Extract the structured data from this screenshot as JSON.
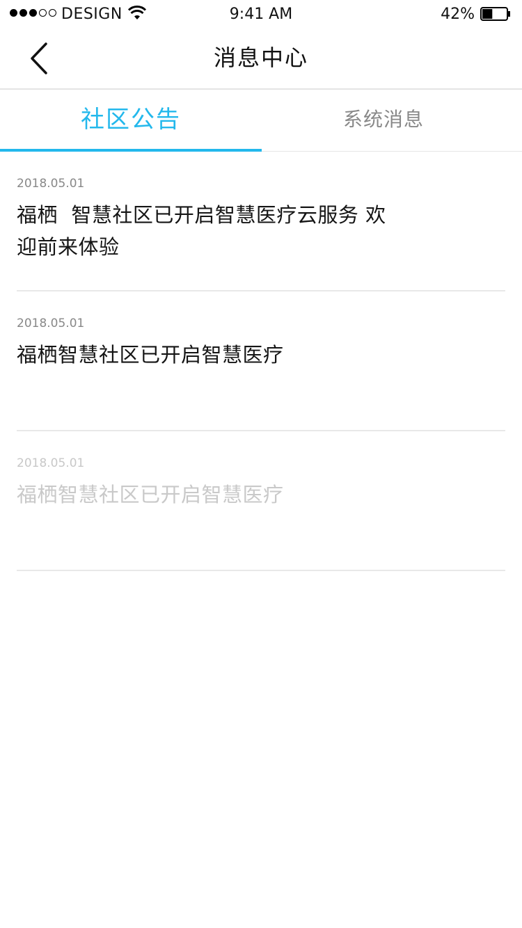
{
  "status_bar": {
    "carrier": "DESIGN",
    "time": "9:41 AM",
    "battery_percent": "42%",
    "battery_level": 0.42,
    "signal_strength": 3,
    "signal_max": 5
  },
  "nav": {
    "title": "消息中心",
    "back_icon": "chevron-left-icon"
  },
  "tabs": [
    {
      "label": "社区公告",
      "active": true
    },
    {
      "label": "系统消息",
      "active": false
    }
  ],
  "colors": {
    "accent": "#23b8ec",
    "muted_text": "#888888",
    "faded_text": "#c9c9c9"
  },
  "messages": [
    {
      "date": "2018.05.01",
      "text": "福栖  智慧社区已开启智慧医疗云服务 欢迎前来体验",
      "read": false
    },
    {
      "date": "2018.05.01",
      "text": "福栖智慧社区已开启智慧医疗",
      "read": false
    },
    {
      "date": "2018.05.01",
      "text": "福栖智慧社区已开启智慧医疗",
      "read": true
    }
  ]
}
